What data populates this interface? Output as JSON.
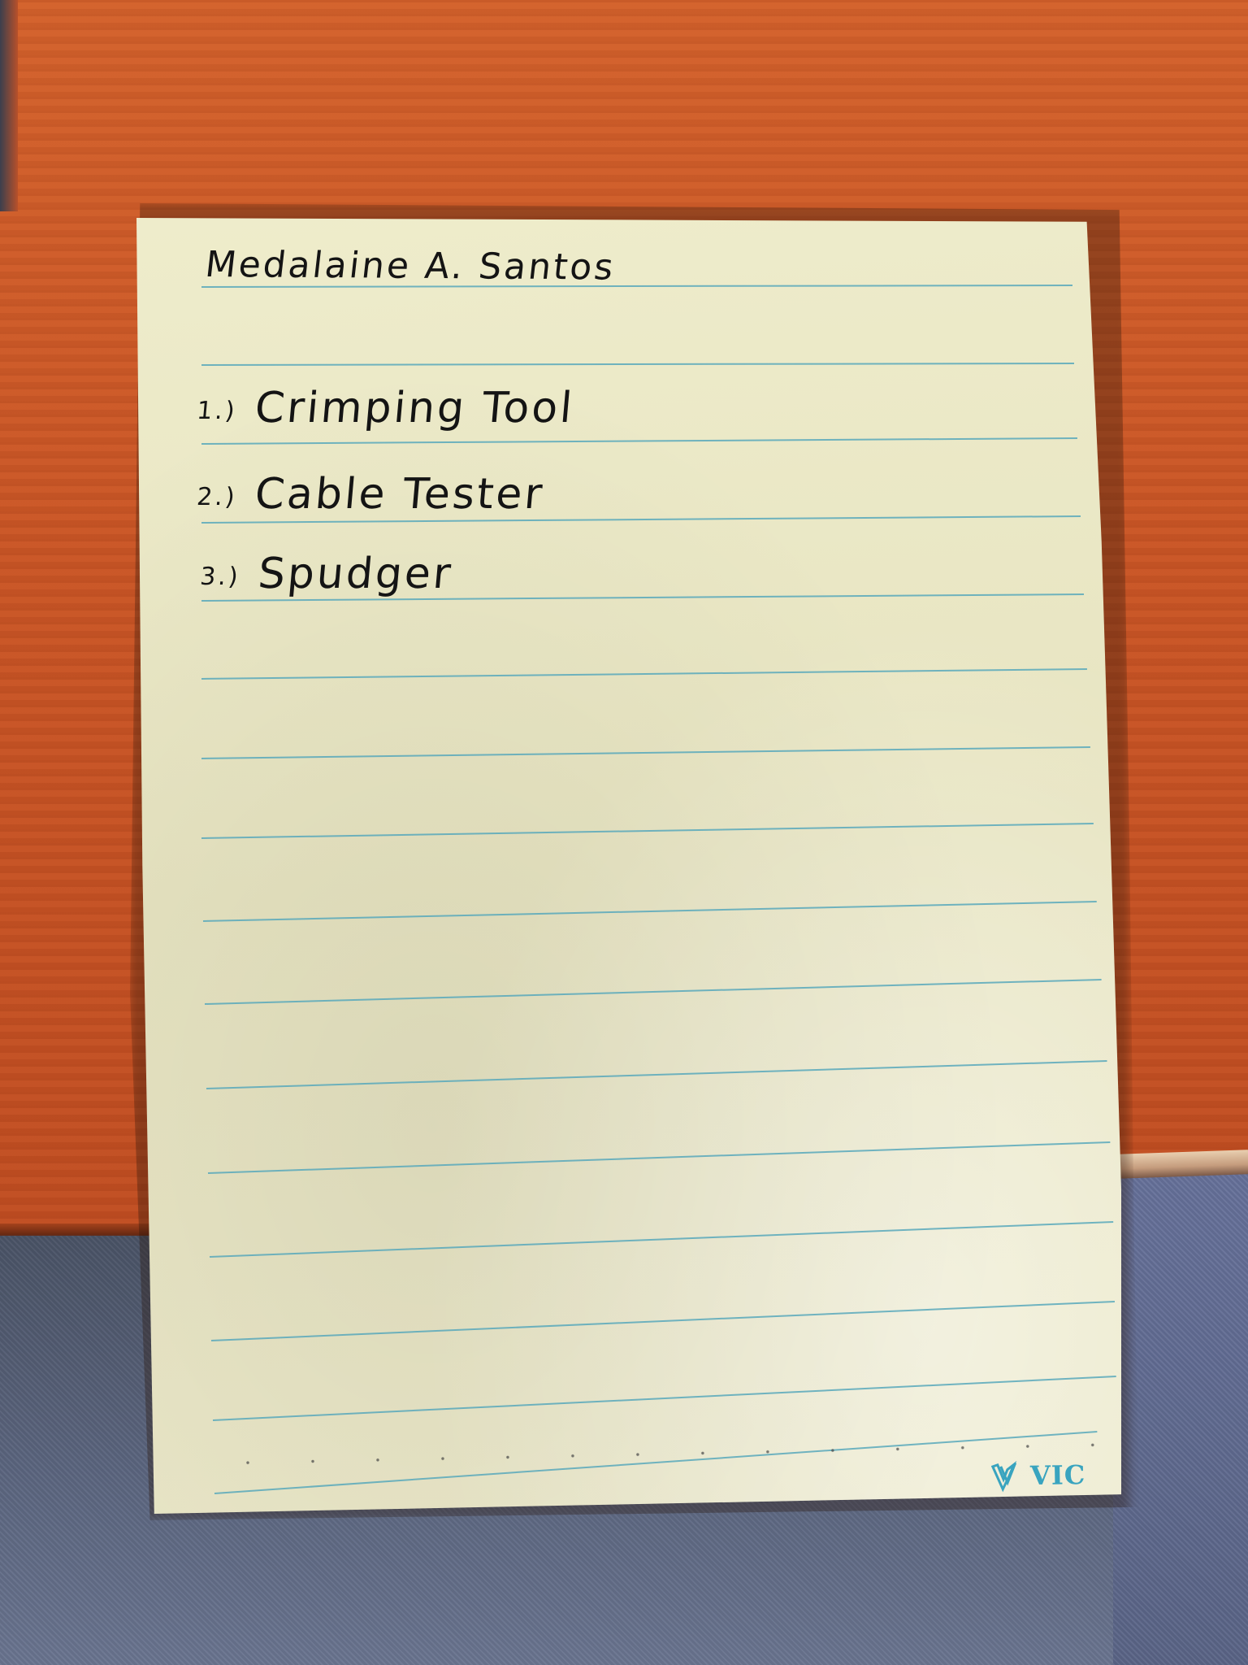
{
  "note": {
    "name": "Medalaine A. Santos",
    "items": [
      {
        "number": "1.)",
        "label": "Crimping Tool"
      },
      {
        "number": "2.)",
        "label": "Cable Tester"
      },
      {
        "number": "3.)",
        "label": "Spudger"
      }
    ]
  },
  "brand": {
    "text": "VIC",
    "color": "#39a4bf",
    "icon": "brand-check-icon"
  },
  "colors": {
    "desk": "#c85526",
    "paper": "#e9e6c5",
    "rule": "#58a8bb",
    "ink": "#141414",
    "fabric": "#5d6781"
  }
}
